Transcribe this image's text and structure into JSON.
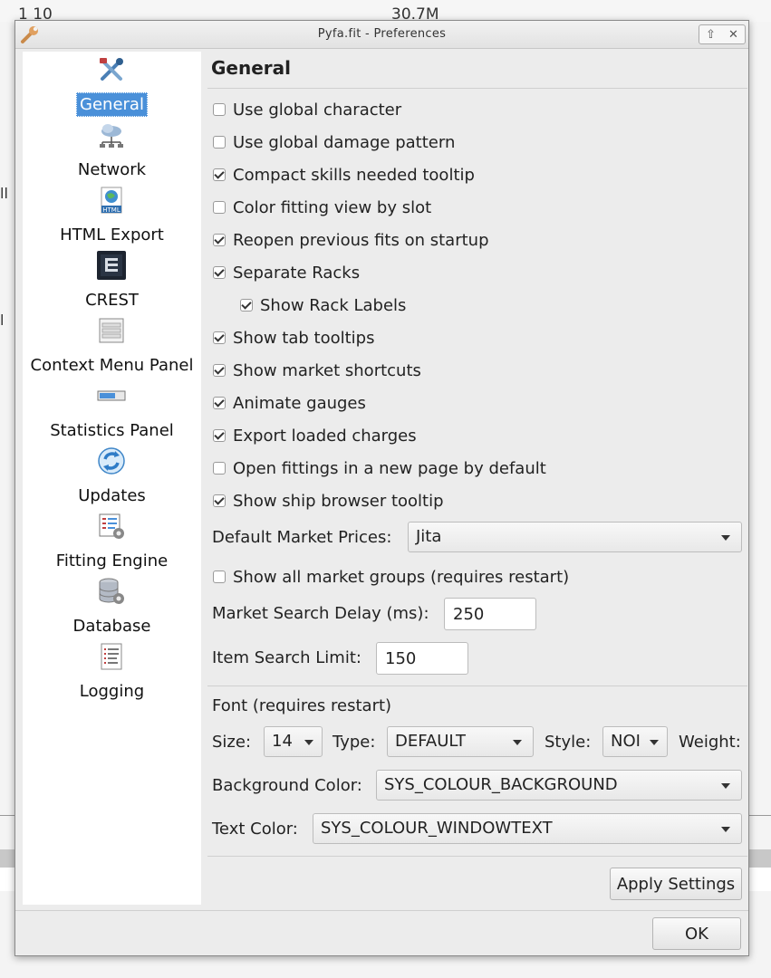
{
  "background": {
    "top_left_text": "1   10",
    "top_center_text": "30.7M"
  },
  "window": {
    "title": "Pyfa.fit - Preferences",
    "buttons": [
      "up-arrow-icon",
      "close-icon"
    ]
  },
  "sidebar": {
    "items": [
      {
        "label": "General",
        "icon": "tools-icon",
        "selected": true
      },
      {
        "label": "Network",
        "icon": "network-icon"
      },
      {
        "label": "HTML Export",
        "icon": "html-export-icon"
      },
      {
        "label": "CREST",
        "icon": "crest-icon"
      },
      {
        "label": "Context Menu Panel",
        "icon": "context-menu-icon"
      },
      {
        "label": "Statistics Panel",
        "icon": "statistics-icon"
      },
      {
        "label": "Updates",
        "icon": "updates-icon"
      },
      {
        "label": "Fitting Engine",
        "icon": "fitting-engine-icon"
      },
      {
        "label": "Database",
        "icon": "database-icon"
      },
      {
        "label": "Logging",
        "icon": "logging-icon"
      }
    ]
  },
  "general": {
    "heading": "General",
    "checkboxes": [
      {
        "label": "Use global character",
        "checked": false
      },
      {
        "label": "Use global damage pattern",
        "checked": false
      },
      {
        "label": "Compact skills needed tooltip",
        "checked": true
      },
      {
        "label": "Color fitting view by slot",
        "checked": false
      },
      {
        "label": "Reopen previous fits on startup",
        "checked": true
      },
      {
        "label": "Separate Racks",
        "checked": true
      },
      {
        "label": "Show Rack Labels",
        "checked": true,
        "indent": true
      },
      {
        "label": "Show tab tooltips",
        "checked": true
      },
      {
        "label": "Show market shortcuts",
        "checked": true
      },
      {
        "label": "Animate gauges",
        "checked": true
      },
      {
        "label": "Export loaded charges",
        "checked": true
      },
      {
        "label": "Open fittings in a new page by default",
        "checked": false
      },
      {
        "label": "Show ship browser tooltip",
        "checked": true
      }
    ],
    "market_prices_label": "Default Market Prices:",
    "market_prices_value": "Jita",
    "show_all_groups": {
      "label": "Show all market groups (requires restart)",
      "checked": false
    },
    "search_delay_label": "Market Search Delay (ms):",
    "search_delay_value": "250",
    "item_limit_label": "Item Search Limit:",
    "item_limit_value": "150",
    "font_section_label": "Font (requires restart)",
    "size_label": "Size:",
    "size_value": "14",
    "type_label": "Type:",
    "type_value": "DEFAULT",
    "style_label": "Style:",
    "style_value": "NOI",
    "weight_label": "Weight:",
    "bg_color_label": "Background Color:",
    "bg_color_value": "SYS_COLOUR_BACKGROUND",
    "text_color_label": "Text Color:",
    "text_color_value": "SYS_COLOUR_WINDOWTEXT",
    "apply_label": "Apply Settings"
  },
  "footer": {
    "ok_label": "OK"
  },
  "colors": {
    "selection": "#4a90d9",
    "window_bg": "#ececec"
  }
}
